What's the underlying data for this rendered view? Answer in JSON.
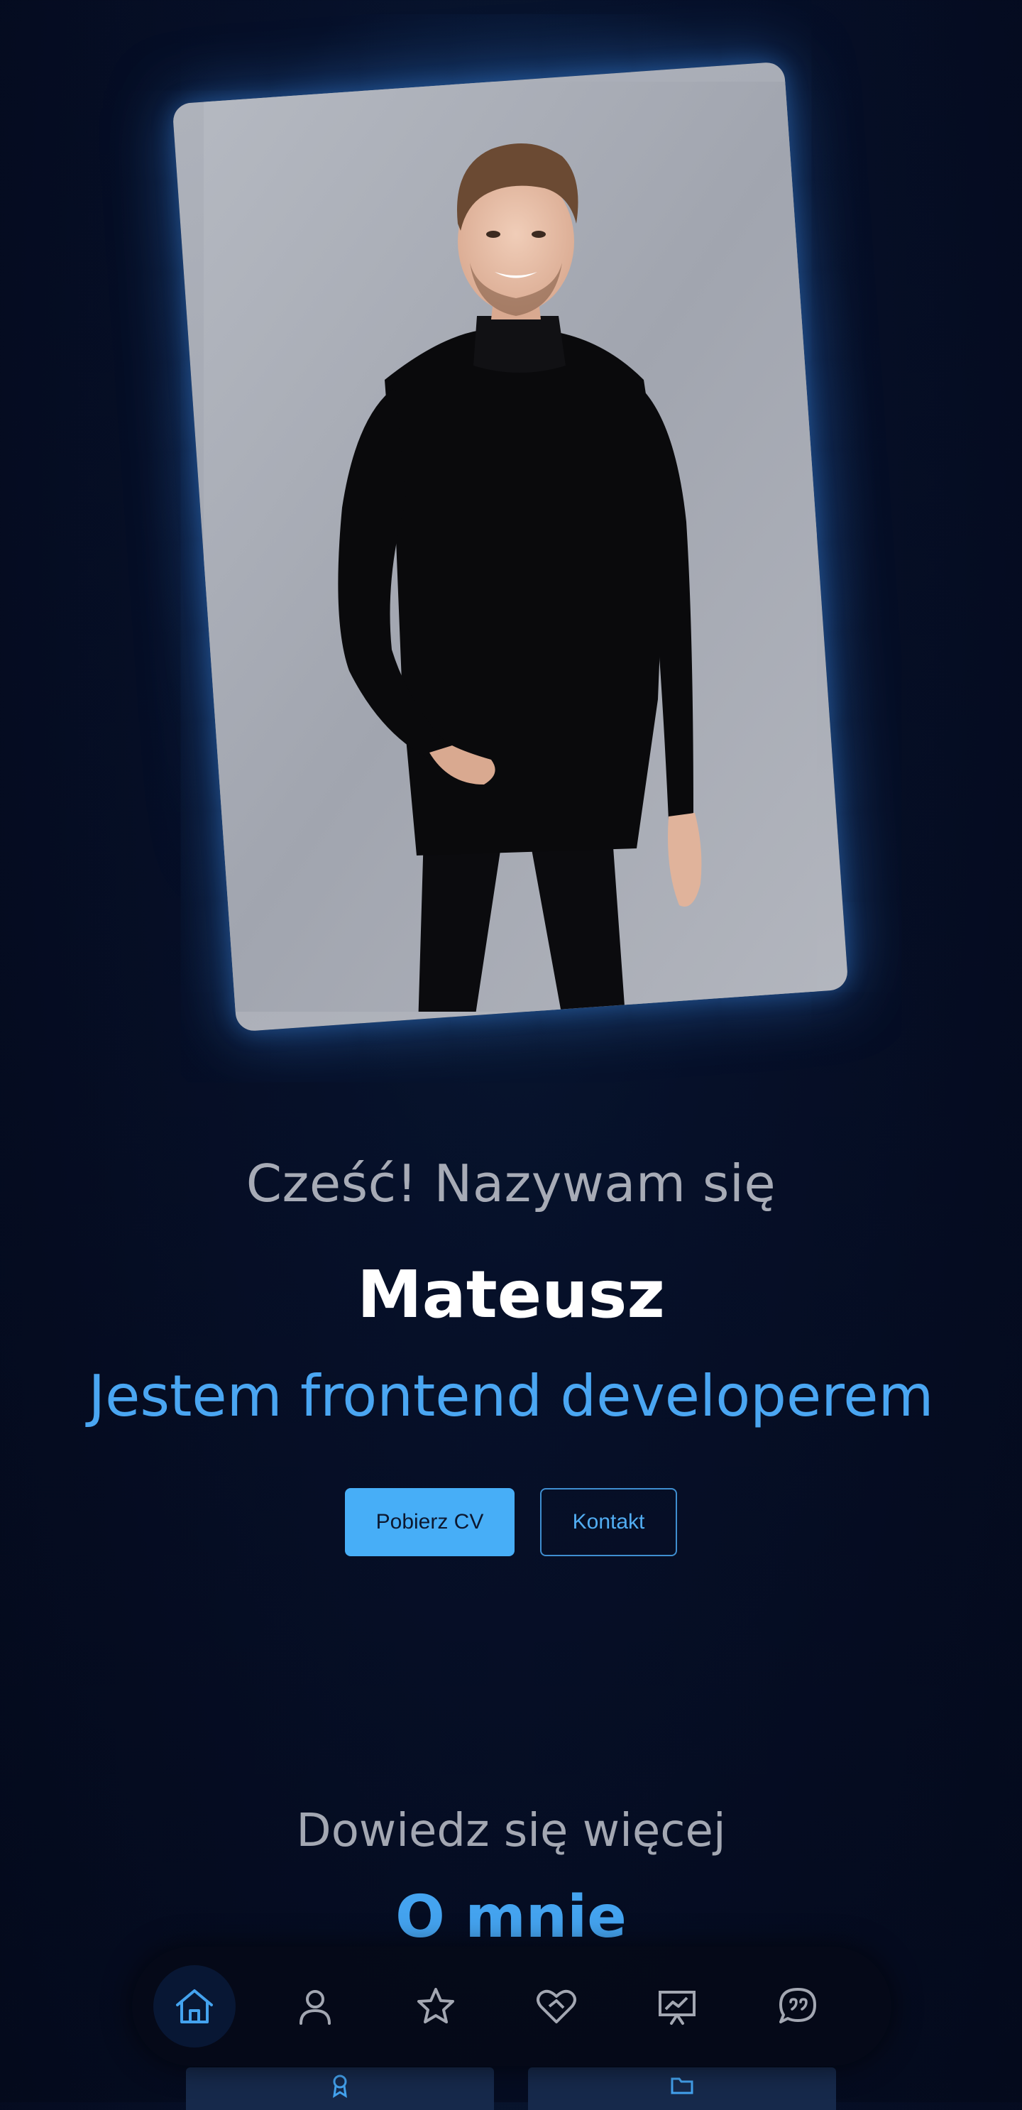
{
  "hero": {
    "greeting": "Cześć! Nazywam się",
    "name": "Mateusz",
    "role": "Jestem frontend developerem",
    "buttons": {
      "download_cv": "Pobierz CV",
      "contact": "Kontakt"
    }
  },
  "section": {
    "subtitle": "Dowiedz się więcej",
    "title": "O mnie"
  },
  "nav": {
    "items": [
      {
        "icon": "home-icon",
        "active": true
      },
      {
        "icon": "user-icon",
        "active": false
      },
      {
        "icon": "star-icon",
        "active": false
      },
      {
        "icon": "handshake-heart-icon",
        "active": false
      },
      {
        "icon": "presentation-chart-icon",
        "active": false
      },
      {
        "icon": "quote-bubble-icon",
        "active": false
      }
    ]
  },
  "colors": {
    "background": "#050c21",
    "accent": "#47aef7",
    "muted_text": "#a7abb6",
    "nav_active_icon": "#44a3ef",
    "nav_icon": "#a3a7b2"
  }
}
